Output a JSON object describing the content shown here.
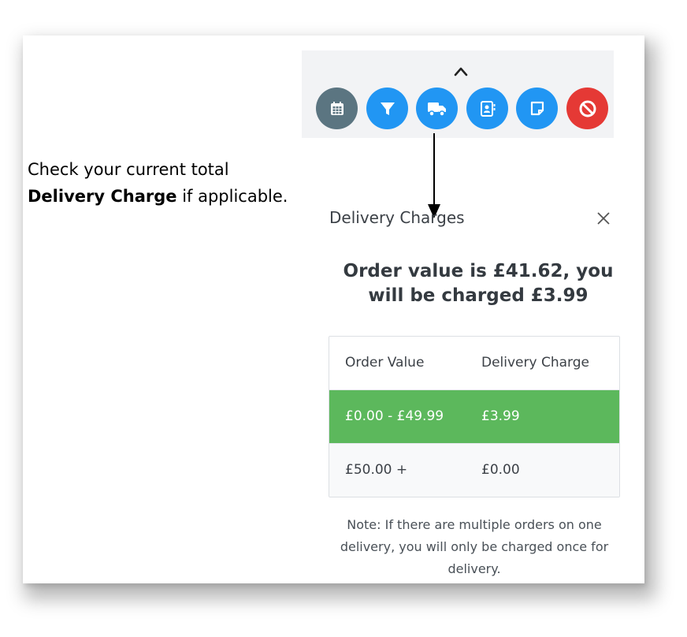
{
  "caption": {
    "line1": "Check your current total",
    "bold": "Delivery Charge",
    "rest": " if applicable."
  },
  "toolbar": {
    "buttons": [
      {
        "icon": "calendar-icon",
        "color": "#5b7581"
      },
      {
        "icon": "filter-icon",
        "color": "#2196f3"
      },
      {
        "icon": "truck-icon",
        "color": "#2196f3"
      },
      {
        "icon": "contacts-icon",
        "color": "#2196f3"
      },
      {
        "icon": "note-icon",
        "color": "#2196f3"
      },
      {
        "icon": "ban-icon",
        "color": "#e53935"
      }
    ]
  },
  "modal": {
    "title": "Delivery Charges",
    "order_message": "Order value is £41.62, you will be charged £3.99",
    "table": {
      "headers": [
        "Order Value",
        "Delivery Charge"
      ],
      "rows": [
        {
          "order_value": "£0.00 - £49.99",
          "delivery_charge": "£3.99",
          "highlighted": true
        },
        {
          "order_value": "£50.00 +",
          "delivery_charge": "£0.00",
          "highlighted": false
        }
      ]
    },
    "note": "Note: If there are multiple orders on one delivery, you will only be charged once for delivery."
  },
  "colors": {
    "highlight_row": "#5cb85c",
    "primary": "#2196f3",
    "danger": "#e53935",
    "secondary": "#5b7581"
  }
}
